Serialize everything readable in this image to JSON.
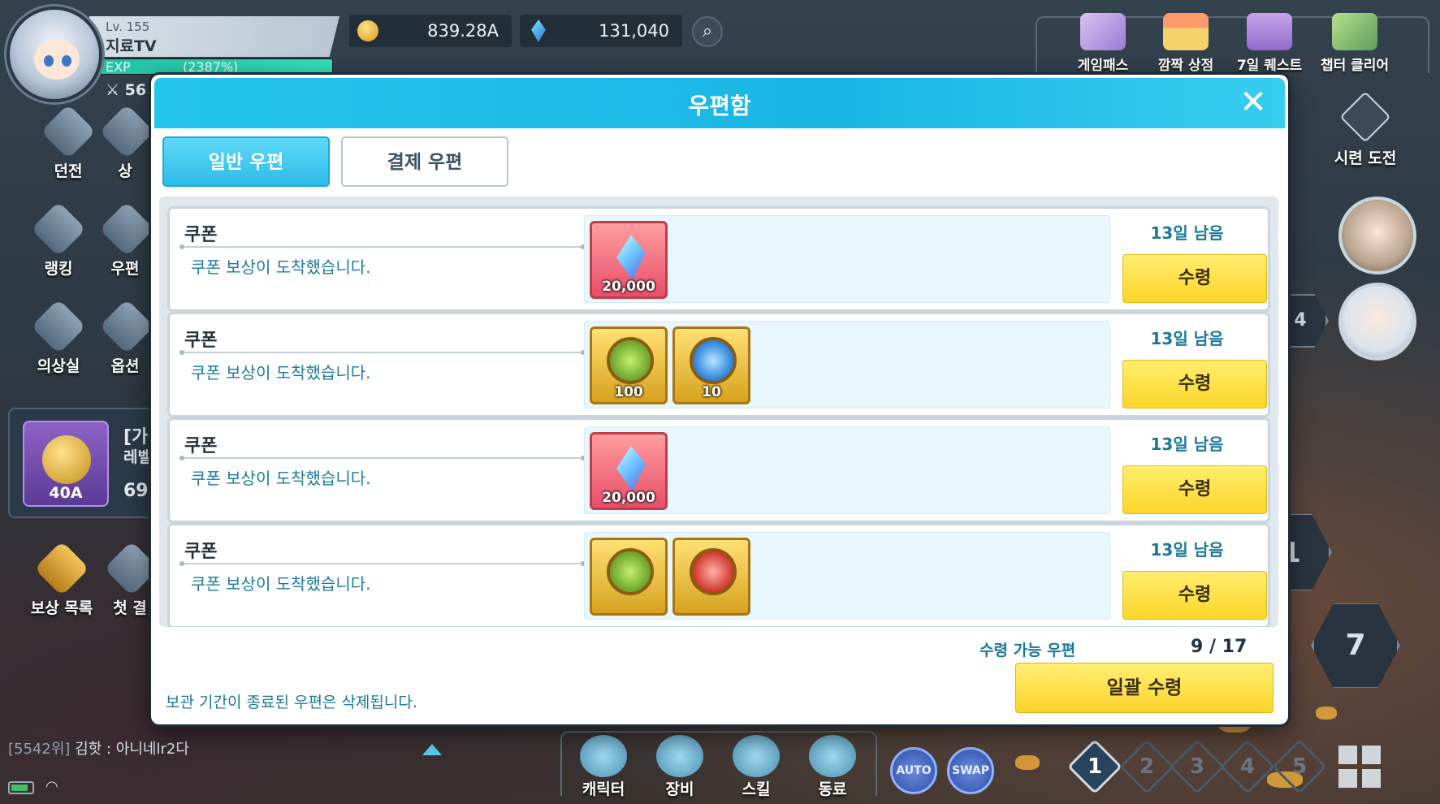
{
  "profile": {
    "level": "Lv. 155",
    "name": "지료TV",
    "exp_label": "EXP",
    "exp_percent": "(2387%)",
    "power": "56"
  },
  "currencies": {
    "gold": "839.28A",
    "gems": "131,040"
  },
  "top_menu": [
    "게임패스",
    "깜짝 상점",
    "7일 퀘스트",
    "챕터 클리어"
  ],
  "left_menu": [
    "던전",
    "상",
    "랭킹",
    "우편",
    "의상실",
    "옵션"
  ],
  "left_panel": {
    "medal_label": "40A",
    "title_fragment": "[가",
    "sub_fragment": "레벨",
    "number_fragment": "69"
  },
  "left_bottom": [
    "보상 목록",
    "첫 결"
  ],
  "right_menu": {
    "trial": "시련 도전",
    "hex_a": "1",
    "hex_b": "7",
    "hex_small": "4"
  },
  "chat": {
    "rank": "[5542위]",
    "message": "김핫 : 아니네lr2다"
  },
  "bottom_menu": [
    "캐릭터",
    "장비",
    "스킬",
    "동료"
  ],
  "round_buttons": [
    "AUTO",
    "SWAP"
  ],
  "slots": [
    "1",
    "2",
    "3",
    "4",
    "5"
  ],
  "modal": {
    "title": "우편함",
    "close": "✕",
    "tabs": [
      "일반 우편",
      "결제 우편"
    ],
    "mails": [
      {
        "title": "쿠폰",
        "message": "쿠폰 보상이 도착했습니다.",
        "days_left": "13일 남음",
        "button": "수령",
        "items": [
          {
            "type": "crystal",
            "qty": "20,000"
          }
        ]
      },
      {
        "title": "쿠폰",
        "message": "쿠폰 보상이 도착했습니다.",
        "days_left": "13일 남음",
        "button": "수령",
        "items": [
          {
            "type": "emblem-green",
            "qty": "100"
          },
          {
            "type": "emblem-blue",
            "qty": "10"
          }
        ]
      },
      {
        "title": "쿠폰",
        "message": "쿠폰 보상이 도착했습니다.",
        "days_left": "13일 남음",
        "button": "수령",
        "items": [
          {
            "type": "crystal",
            "qty": "20,000"
          }
        ]
      },
      {
        "title": "쿠폰",
        "message": "쿠폰 보상이 도착했습니다.",
        "days_left": "13일 남음",
        "button": "수령",
        "items": [
          {
            "type": "emblem-green",
            "qty": ""
          },
          {
            "type": "emblem-red",
            "qty": ""
          }
        ]
      }
    ],
    "claimable_label": "수령 가능 우편",
    "claimable_count": "9 / 17",
    "claim_all": "일괄 수령",
    "notice": "보관 기간이 종료된 우편은 삭제됩니다."
  },
  "colors": {
    "header": "#19b6e4",
    "accent_text": "#1b7898",
    "claim_button": "#fbd629"
  }
}
